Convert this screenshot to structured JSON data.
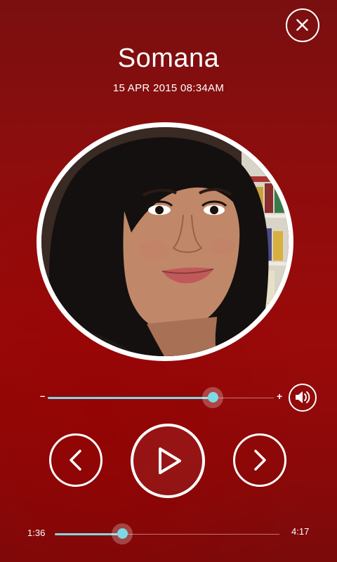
{
  "header": {
    "title": "Somana",
    "datetime": "15 APR 2015  08:34AM",
    "close_icon": "close-icon"
  },
  "avatar": {
    "kind": "photo-portrait"
  },
  "volume": {
    "minus_label": "–",
    "plus_label": "+",
    "level_fraction": 0.73,
    "icon": "speaker-icon"
  },
  "controls": {
    "previous_icon": "chevron-left-icon",
    "play_icon": "play-icon",
    "next_icon": "chevron-right-icon"
  },
  "progress": {
    "elapsed": "1:36",
    "total": "4:17",
    "fraction": 0.3
  },
  "colors": {
    "accent": "#7fd8e6",
    "background": "#8e0d0d",
    "foreground": "#ffffff"
  }
}
